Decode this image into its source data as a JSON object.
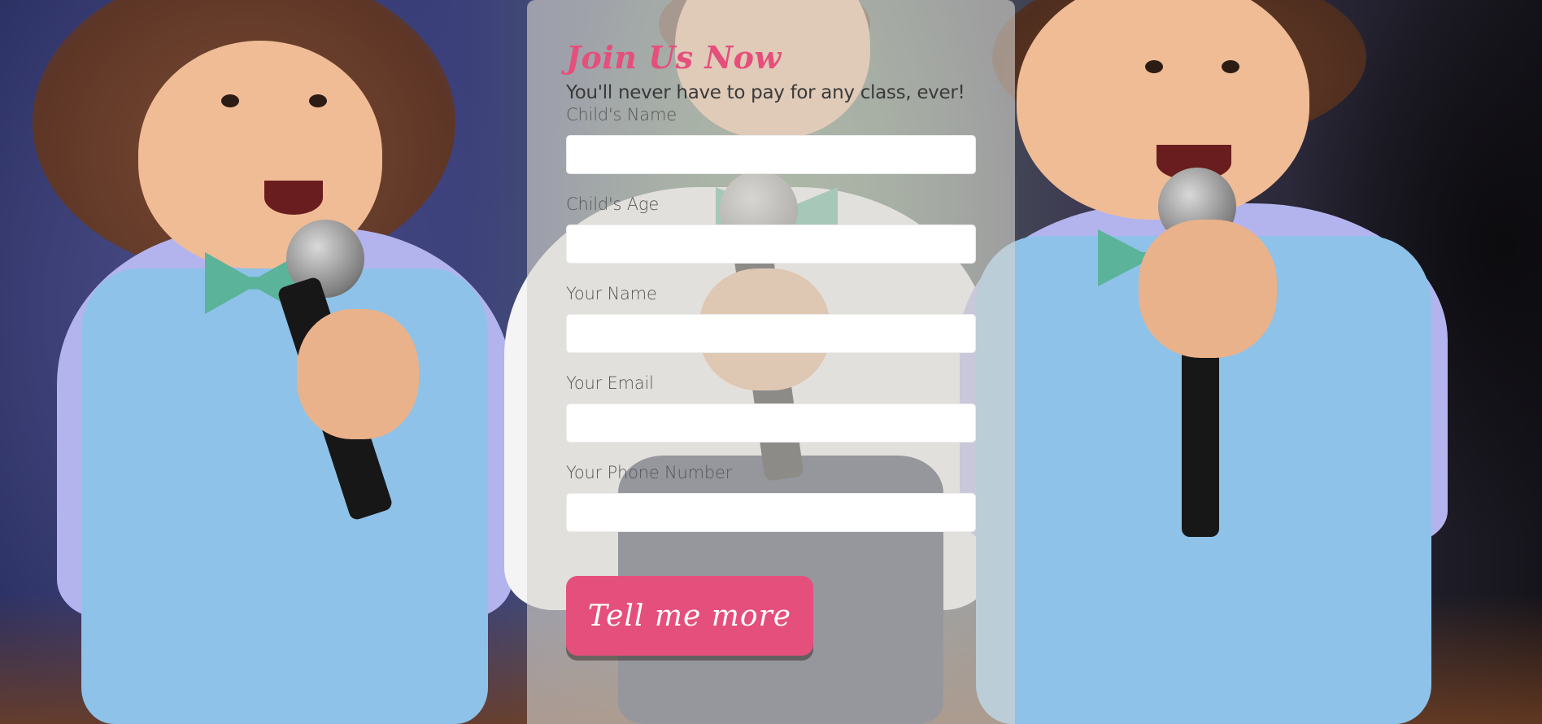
{
  "form": {
    "title": "Join Us Now",
    "subtitle": "You'll never have to pay for any class, ever!",
    "fields": [
      {
        "label": "Child's Name",
        "value": "",
        "placeholder": ""
      },
      {
        "label": "Child's Age",
        "value": "",
        "placeholder": ""
      },
      {
        "label": "Your Name",
        "value": "",
        "placeholder": ""
      },
      {
        "label": "Your Email",
        "value": "",
        "placeholder": ""
      },
      {
        "label": "Your Phone Number",
        "value": "",
        "placeholder": ""
      }
    ],
    "submit_label": "Tell me more"
  },
  "colors": {
    "accent": "#e54f7c",
    "panel": "rgba(215,212,205,0.62)",
    "input_bg": "#ffffff"
  }
}
